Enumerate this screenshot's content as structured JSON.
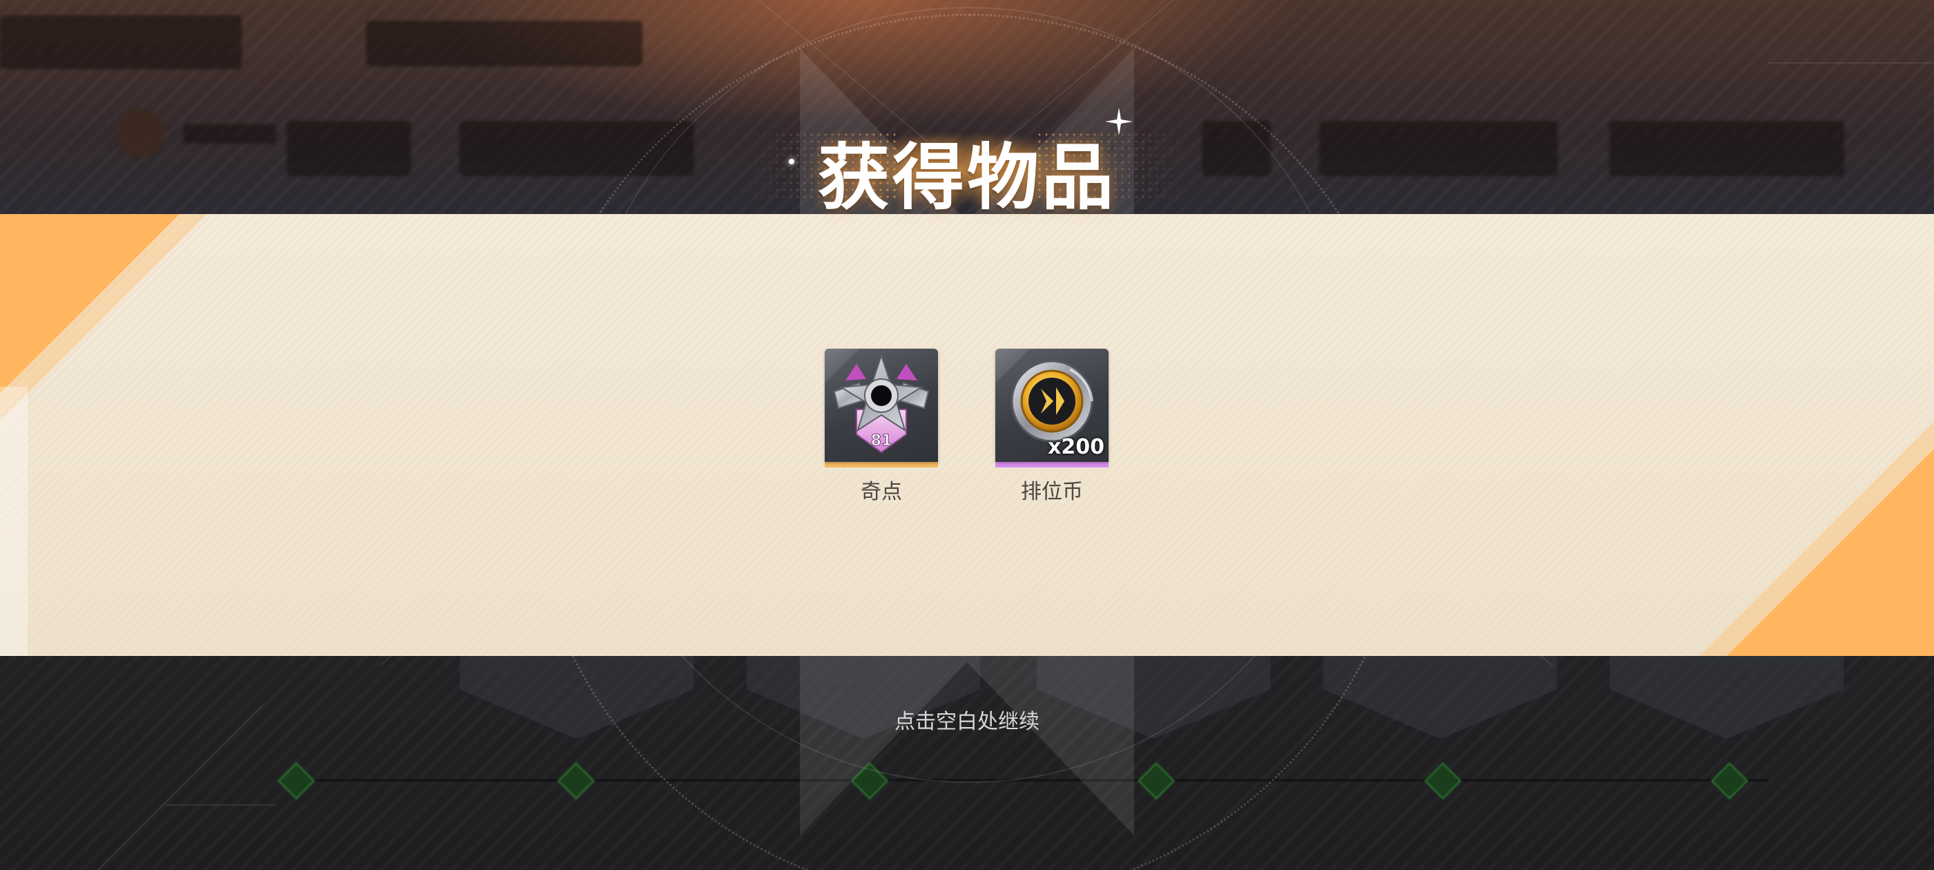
{
  "dialog": {
    "title": "获得物品",
    "continue_hint": "点击空白处继续"
  },
  "rewards": [
    {
      "name": "奇点",
      "icon": "singularity-emblem-icon",
      "quantity": "",
      "rarity_color": "#f4b860"
    },
    {
      "name": "排位币",
      "icon": "ranked-coin-icon",
      "quantity": "x200",
      "rarity_color": "#d98cf0"
    }
  ],
  "colors": {
    "panel_background": "#f2e6d3",
    "accent_orange": "#ffb65e",
    "title_glow": "#ffaf50"
  }
}
